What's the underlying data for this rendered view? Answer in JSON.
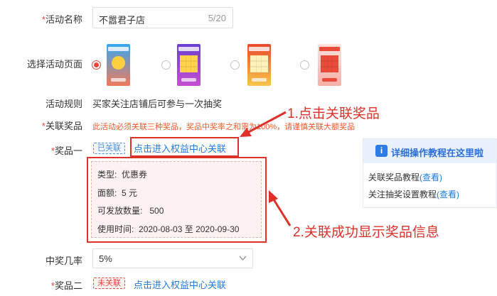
{
  "form": {
    "activity_name": {
      "required_mark": "*",
      "label": "活动名称",
      "value": "不嚣君子店",
      "count": "5/20"
    },
    "page_select": {
      "label": "选择活动页面",
      "thumb_texts": [
        "拼手气赢",
        "关注店铺赢大奖",
        "关注赢大奖",
        "关注有礼 赢取惊喜"
      ]
    },
    "rules": {
      "label": "活动规则",
      "text": "买家关注店铺后可参与一次抽奖"
    },
    "related_prizes": {
      "required_mark": "*",
      "label": "关联奖品",
      "warning": "此活动必须关联三种奖品，奖品中奖率之和需为100%，请谨慎关联大额奖品"
    },
    "prize1": {
      "required_mark": "*",
      "label": "奖品一",
      "tag": "已关联",
      "link": "点击进入权益中心关联"
    },
    "prize_info": {
      "type_label": "类型:",
      "type_value": "优惠券",
      "amount_label": "面额:",
      "amount_value": "5 元",
      "qty_label": "可发放数量:",
      "qty_value": "500",
      "time_label": "使用时间:",
      "time_value": "2020-08-03 至 2020-09-30"
    },
    "win_rate": {
      "label": "中奖几率",
      "value": "5%"
    },
    "prize2": {
      "required_mark": "*",
      "label": "奖品二",
      "tag": "未关联",
      "link": "点击进入权益中心关联"
    }
  },
  "annotations": {
    "step1": "1.点击关联奖品",
    "step2": "2.关联成功显示奖品信息"
  },
  "help": {
    "title": "详细操作教程在这里啦",
    "link1_text": "关联奖品教程",
    "link1_action": "(查看)",
    "link2_text": "关注抽奖设置教程",
    "link2_action": "(查看)"
  },
  "colors": {
    "accent_red": "#e0302a",
    "link_blue": "#1e7be0",
    "linked_tag": "#4a8fe0",
    "unlinked_tag": "#e6453c",
    "warning_text": "#f05a2a"
  }
}
